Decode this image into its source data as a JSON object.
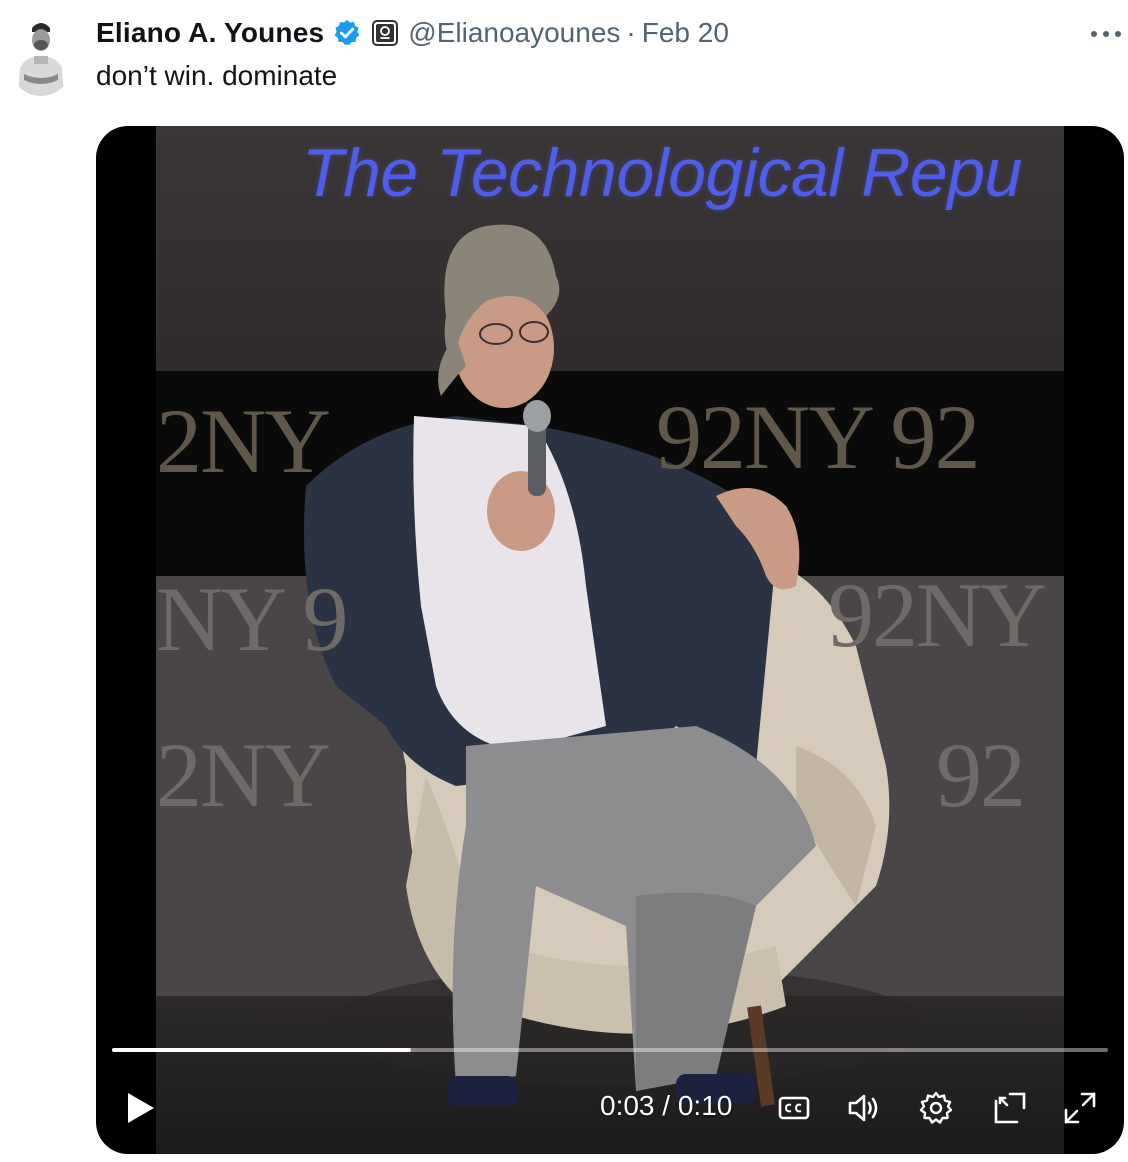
{
  "tweet": {
    "author": {
      "display_name": "Eliano A. Younes",
      "handle": "@Elianoayounes",
      "verified": true,
      "avatar_icon": "avatar-photo"
    },
    "separator": "·",
    "timestamp": "Feb 20",
    "text": "don’t win. dominate",
    "more_icon": "more-horizontal-icon"
  },
  "video": {
    "slide_text": "The Technological Repu",
    "watermarks": [
      "2NY",
      "92NY 92",
      "NY 9",
      "92NY",
      "2NY",
      "92"
    ],
    "progress": 0.3,
    "current_time": "0:03",
    "time_separator": "/",
    "duration": "0:10",
    "controls": [
      "play-icon",
      "captions-icon",
      "volume-icon",
      "settings-icon",
      "pop-out-icon",
      "fullscreen-icon"
    ]
  },
  "colors": {
    "text_primary": "#0f1419",
    "text_secondary": "#536471",
    "verified_blue": "#1d9bf0",
    "slide_title_blue": "#4f5de8"
  }
}
